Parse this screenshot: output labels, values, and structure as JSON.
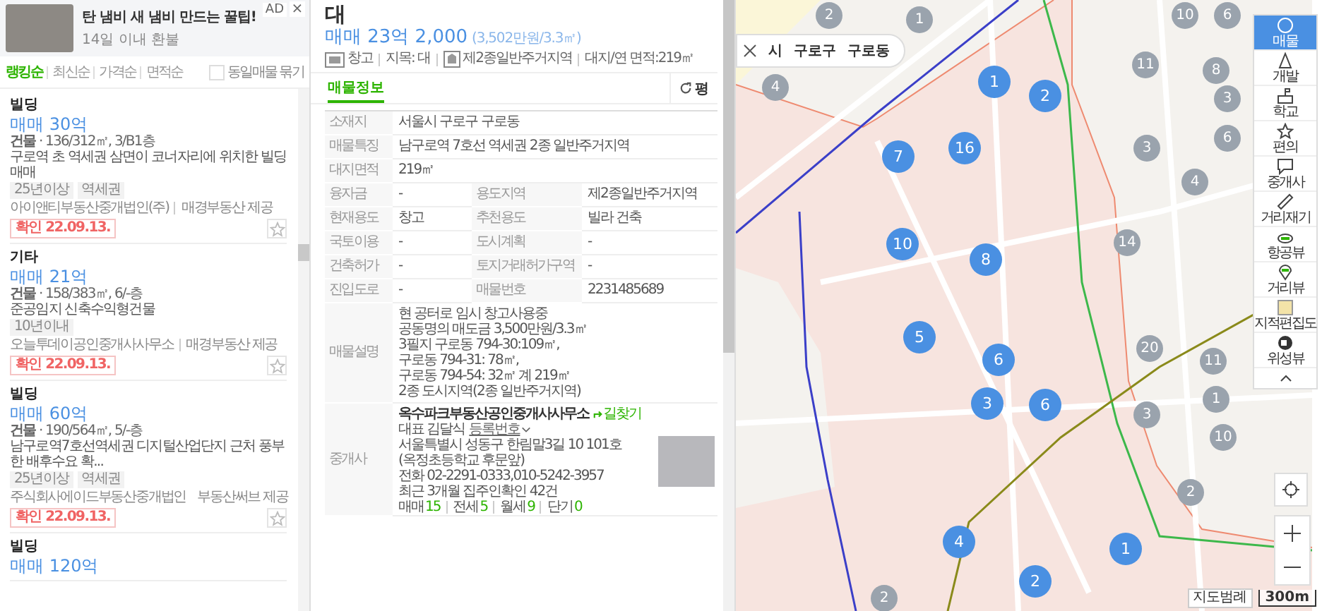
{
  "ad": {
    "badge": "AD",
    "close": "×",
    "title": "탄 냄비 새 냄비 만드는 꿀팁!",
    "subtitle": "14일 이내 환불"
  },
  "sort_tabs": [
    {
      "label": "랭킹순",
      "selected": true
    },
    {
      "label": "최신순",
      "selected": false
    },
    {
      "label": "가격순",
      "selected": false
    },
    {
      "label": "면적순",
      "selected": false
    }
  ],
  "group_same": {
    "label": "동일매물 묶기",
    "checked": false
  },
  "listings": [
    {
      "type": "빌딩",
      "price": "매매 30억",
      "spec": "**건물** · 136/312㎡, 3/B1층",
      "description": "구로역 초 역세권 삼면이 코너자리에 위치한 빌딩 매매",
      "tags": [
        "25년이상",
        "역세권"
      ],
      "agency": "아이앤티부동산중개법인(주)",
      "provider": "매경부동산 제공",
      "confirmed": "확인 22.09.13.",
      "favorite": false
    },
    {
      "type": "기타",
      "price": "매매 21억",
      "spec": "**건물** · 158/383㎡, 6/-층",
      "description": "준공임지 신축수익형건물",
      "tags": [
        "10년이내"
      ],
      "agency": "오늘투데이공인중개사사무소",
      "provider": "매경부동산 제공",
      "confirmed": "확인 22.09.13.",
      "favorite": false
    },
    {
      "type": "빌딩",
      "price": "매매 60억",
      "spec": "**건물** · 190/564㎡, 5/-층",
      "description": "남구로역7호선역세권 디지털산업단지 근처 풍부한 배후수요 확...",
      "tags": [
        "25년이상",
        "역세권"
      ],
      "agency": "주식회사에이드부동산중개법인",
      "provider": "부동산써브 제공",
      "confirmed": "확인 22.09.13.",
      "favorite": false
    },
    {
      "type": "빌딩",
      "price": "매매 120억"
    }
  ],
  "detail": {
    "title": "대",
    "price": "매매 23억 2,000",
    "unit_price": "(3,502만원/3.3㎡)",
    "summary": [
      {
        "kind": "use",
        "text": "창고"
      },
      {
        "kind": "plain",
        "text": "지목: 대"
      },
      {
        "kind": "zone",
        "text": "제2종일반주거지역"
      },
      {
        "kind": "plain",
        "text": "대지/연 면적:219㎡"
      }
    ],
    "tabs": [
      {
        "label": "매물정보",
        "selected": true
      }
    ],
    "unit_toggle": "평",
    "rows": [
      [
        {
          "label": "소재지",
          "value": "서울시 구로구 구로동"
        }
      ],
      [
        {
          "label": "매물특징",
          "value": "남구로역 7호선 역세권 2종 일반주거지역"
        }
      ],
      [
        {
          "label": "대지면적",
          "value": "219㎡"
        }
      ],
      [
        {
          "label": "융자금",
          "value": "-"
        },
        {
          "label": "용도지역",
          "value": "제2종일반주거지역"
        }
      ],
      [
        {
          "label": "현재용도",
          "value": "창고"
        },
        {
          "label": "추천용도",
          "value": "빌라 건축"
        }
      ],
      [
        {
          "label": "국토이용",
          "value": "-"
        },
        {
          "label": "도시계획",
          "value": "-"
        }
      ],
      [
        {
          "label": "건축허가",
          "value": "-"
        },
        {
          "label": "토지거래허가구역",
          "value": "-"
        }
      ],
      [
        {
          "label": "진입도로",
          "value": "-"
        },
        {
          "label": "매물번호",
          "value": "2231485689"
        }
      ]
    ],
    "description": {
      "label": "매물설명",
      "lines": [
        "현 공터로 임시 창고사용중",
        "공동명의 매도금 3,500만원/3.3㎡",
        "3필지 구로동 794-30:109㎡,",
        "구로동 794-31: 78㎡,",
        "구로동 794-54: 32㎡ 계 219㎡",
        "2종 도시지역(2종 일반주거지역)"
      ]
    },
    "agent": {
      "label": "중개사",
      "name": "옥수파크부동산공인중개사사무소",
      "directions": "길찾기",
      "representative": "대표 김달식",
      "registration": "등록번호",
      "address": "서울특별시 성동구 한림말3길 10 101호",
      "address_note": "(옥정초등학교 후문앞)",
      "phone": "전화 02-2291-0333,010-5242-3957",
      "verified": "최근 3개월 집주인확인 42건",
      "counts": [
        {
          "label": "매매",
          "value": "15"
        },
        {
          "label": "전세",
          "value": "5"
        },
        {
          "label": "월세",
          "value": "9"
        },
        {
          "label": "단기",
          "value": "0"
        }
      ]
    }
  },
  "map": {
    "breadcrumb": [
      "시",
      "구로구",
      "구로동"
    ],
    "clusters": [
      {
        "count": "1",
        "highlighted": true
      },
      {
        "count": "2",
        "highlighted": true
      },
      {
        "count": "16",
        "highlighted": true
      },
      {
        "count": "7",
        "highlighted": true
      },
      {
        "count": "10",
        "highlighted": true
      },
      {
        "count": "8",
        "highlighted": true
      },
      {
        "count": "5",
        "highlighted": true
      },
      {
        "count": "6",
        "highlighted": true
      },
      {
        "count": "3",
        "highlighted": true
      },
      {
        "count": "6",
        "highlighted": true
      },
      {
        "count": "4",
        "highlighted": true
      },
      {
        "count": "1",
        "highlighted": true
      },
      {
        "count": "2",
        "highlighted": true
      },
      {
        "count": "2",
        "highlighted": false
      },
      {
        "count": "1",
        "highlighted": false
      },
      {
        "count": "4",
        "highlighted": false
      },
      {
        "count": "10",
        "highlighted": false
      },
      {
        "count": "6",
        "highlighted": false
      },
      {
        "count": "11",
        "highlighted": false
      },
      {
        "count": "8",
        "highlighted": false
      },
      {
        "count": "3",
        "highlighted": false
      },
      {
        "count": "6",
        "highlighted": false
      },
      {
        "count": "3",
        "highlighted": false
      },
      {
        "count": "4",
        "highlighted": false
      },
      {
        "count": "14",
        "highlighted": false
      },
      {
        "count": "20",
        "highlighted": false
      },
      {
        "count": "11",
        "highlighted": false
      },
      {
        "count": "1",
        "highlighted": false
      },
      {
        "count": "3",
        "highlighted": false
      },
      {
        "count": "10",
        "highlighted": false
      },
      {
        "count": "2",
        "highlighted": false
      },
      {
        "count": "2",
        "highlighted": false
      }
    ],
    "tools": [
      {
        "label": "매물",
        "selected": true
      },
      {
        "label": "개발",
        "selected": false
      },
      {
        "label": "학교",
        "selected": false
      },
      {
        "label": "편의",
        "selected": false
      },
      {
        "label": "중개사",
        "selected": false
      },
      {
        "label": "거리재기",
        "selected": false
      },
      {
        "label": "항공뷰",
        "selected": false
      },
      {
        "label": "거리뷰",
        "selected": false
      },
      {
        "label": "지적편집도",
        "selected": false
      },
      {
        "label": "위성뷰",
        "selected": false
      }
    ],
    "legend": "지도범례",
    "scale": "300m"
  }
}
